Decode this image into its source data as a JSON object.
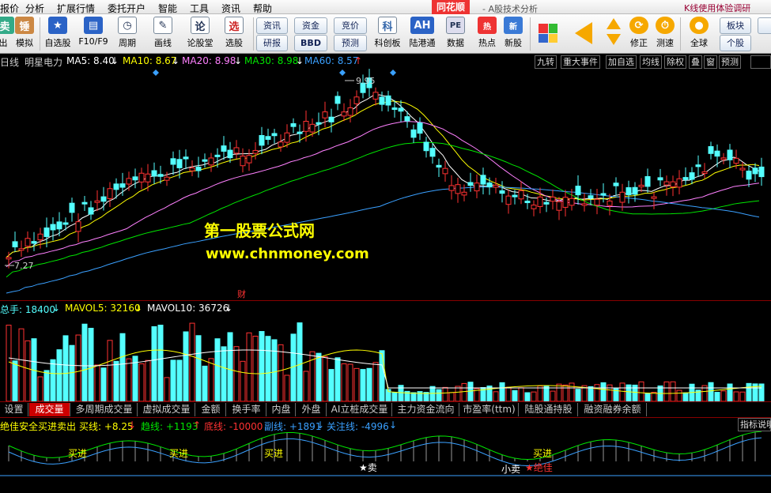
{
  "menu": {
    "items": [
      "报价",
      "分析",
      "扩展行情",
      "委托开户",
      "智能",
      "工具",
      "资讯",
      "帮助"
    ],
    "brand": "同花顺",
    "title": "- A股技术分析",
    "right": "K线使用体验调研"
  },
  "toolbar": {
    "buttons": [
      {
        "label": "出",
        "icon": "卖"
      },
      {
        "label": "模拟",
        "icon": "锤"
      },
      {
        "label": "自选股",
        "icon": "★"
      },
      {
        "label": "F10/F9",
        "icon": "▤"
      },
      {
        "label": "周期",
        "icon": "◷"
      },
      {
        "label": "画线",
        "icon": "✎"
      },
      {
        "label": "论股堂",
        "icon": "论"
      },
      {
        "label": "选股",
        "icon": "选"
      },
      {
        "label": "科创板",
        "icon": "科"
      },
      {
        "label": "陆港通",
        "icon": "AH"
      },
      {
        "label": "数据",
        "icon": "PE"
      },
      {
        "label": "热点",
        "icon": "热"
      },
      {
        "label": "新股",
        "icon": "新"
      },
      {
        "label": "修正",
        "icon": "⟳"
      },
      {
        "label": "测速",
        "icon": "⏱"
      },
      {
        "label": "全球",
        "icon": "●"
      }
    ],
    "small": {
      "zixun": "资讯",
      "yanbao": "研报",
      "zijin": "资金",
      "bbd": "BBD",
      "jingjia": "竞价",
      "yuce": "预测",
      "bankuai": "板块",
      "gegu": "个股"
    }
  },
  "info": {
    "period": "日线",
    "name": "明星电力",
    "ma5": "MA5: 8.40",
    "ma10": "MA10: 8.67",
    "ma20": "MA20: 8.98",
    "ma30": "MA30: 8.98",
    "ma60": "MA60: 8.57",
    "right_buttons": [
      "九转",
      "重大事件",
      "加自选",
      "均线",
      "除权",
      "叠",
      "窗",
      "预测"
    ]
  },
  "chart": {
    "high": "9.95",
    "low": "7.27",
    "caibao": "财",
    "colors": {
      "up": "#ff3232",
      "down": "#54ffff",
      "ma5": "#ffffff",
      "ma10": "#ffff00",
      "ma20": "#ff80ff",
      "ma30": "#00e600",
      "ma60": "#3aa0ff"
    }
  },
  "watermark": {
    "line1": "第一股票公式网",
    "line2": "www.chnmoney.com"
  },
  "volume": {
    "total": "总手: 18400",
    "mavol5": "MAVOL5: 32160",
    "mavol10": "MAVOL10: 36726"
  },
  "tabs": [
    "设置",
    "成交量",
    "多周期成交量",
    "虚拟成交量",
    "金额",
    "换手率",
    "内盘",
    "外盘",
    "AI立桩成交量",
    "主力资金流向",
    "市盈率(ttm)",
    "陆股通持股",
    "融资融券余额"
  ],
  "indicator": {
    "name": "绝佳安全买进卖出",
    "buy": "买线: +8.25",
    "trend": "趋线: +1193",
    "bottom": "底线: -10000",
    "sub": "副线: +1891",
    "focus": "关注线: -4996",
    "explain": "指标说明",
    "labels": [
      "买进",
      "买进",
      "买进",
      "买进",
      "★卖",
      "小卖",
      "★绝佳"
    ]
  }
}
